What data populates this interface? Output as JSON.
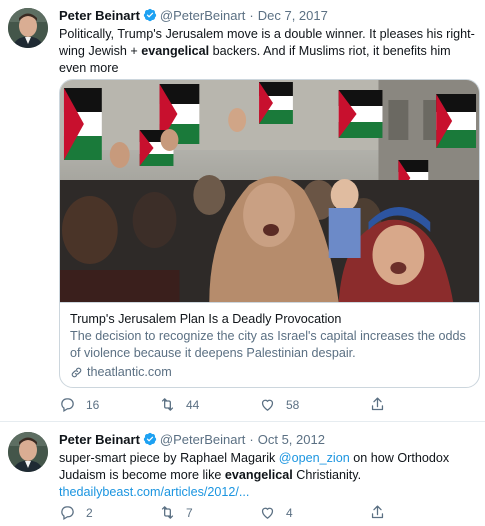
{
  "tweets": [
    {
      "name": "Peter Beinart",
      "handle": "@PeterBeinart",
      "separator": "·",
      "date": "Dec 7, 2017",
      "text_parts": {
        "p1": "Politically, Trump's Jerusalem move is a double winner. It pleases his right-wing Jewish + ",
        "bold": "evangelical",
        "p2": " backers. And if Muslims riot, it benefits him even more"
      },
      "card": {
        "title": "Trump's Jerusalem Plan Is a Deadly Provocation",
        "description": "The decision to recognize the city as Israel's capital increases the odds of violence because it deepens Palestinian despair.",
        "domain": "theatlantic.com"
      },
      "actions": {
        "replies": "16",
        "retweets": "44",
        "likes": "58"
      }
    },
    {
      "name": "Peter Beinart",
      "handle": "@PeterBeinart",
      "separator": "·",
      "date": "Oct 5, 2012",
      "text_parts": {
        "p1": "super-smart piece by Raphael Magarik ",
        "mention": "@open_zion",
        "p2": " on how Orthodox Judaism is become more like ",
        "bold": "evangelical",
        "p3": " Christianity.",
        "link": "thedailybeast.com/articles/2012/..."
      },
      "actions": {
        "replies": "2",
        "retweets": "7",
        "likes": "4"
      }
    }
  ],
  "colors": {
    "accent": "#1b95e0",
    "verified": "#1da1f2",
    "muted": "#5b7083",
    "border": "#ccd6dd"
  },
  "icons": {
    "reply": "reply-icon",
    "retweet": "retweet-icon",
    "like": "heart-icon",
    "share": "share-icon",
    "link": "link-icon",
    "verified": "verified-badge-icon"
  }
}
